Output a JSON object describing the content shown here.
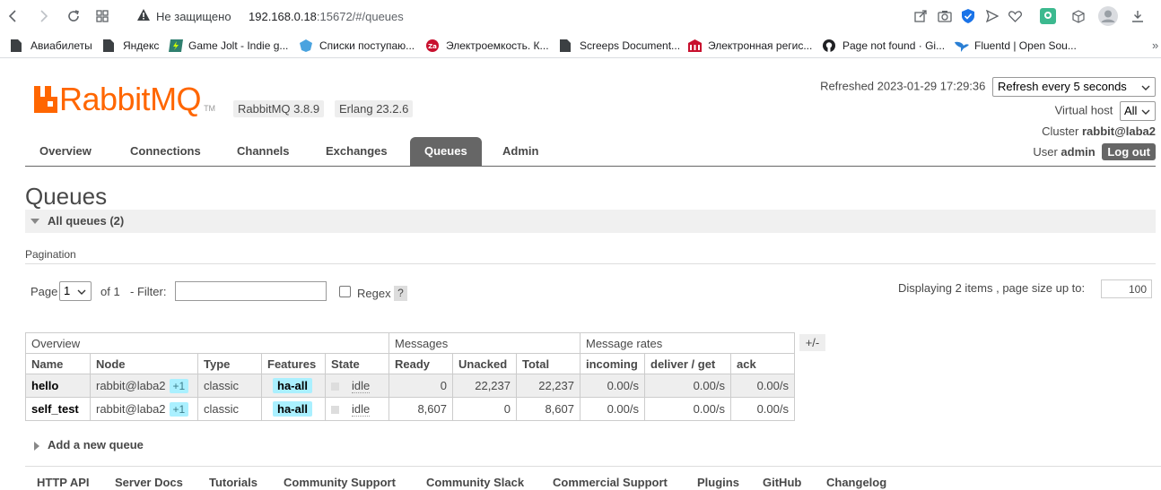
{
  "browser": {
    "insecure_label": "Не защищено",
    "url_host": "192.168.0.18",
    "url_rest": ":15672/#/queues",
    "bookmarks": [
      "Авиабилеты",
      "Яндекс",
      "Game Jolt - Indie g...",
      "Списки поступаю...",
      "Электроемкость. К...",
      "Screeps Document...",
      "Электронная регис...",
      "Page not found · Gi...",
      "Fluentd | Open Sou..."
    ],
    "more": "»"
  },
  "header": {
    "logo_text": "RabbitMQ",
    "logo_tm": "TM",
    "rabbit_version": "RabbitMQ 3.8.9",
    "erlang_version": "Erlang 23.2.6",
    "refreshed_label": "Refreshed 2023-01-29 17:29:36",
    "refresh_select": "Refresh every 5 seconds",
    "vhost_label": "Virtual host",
    "vhost_value": "All",
    "cluster_label": "Cluster",
    "cluster_value": "rabbit@laba2",
    "user_label": "User",
    "user_value": "admin",
    "logout": "Log out"
  },
  "tabs": [
    "Overview",
    "Connections",
    "Channels",
    "Exchanges",
    "Queues",
    "Admin"
  ],
  "active_tab": "Queues",
  "page_title": "Queues",
  "section": {
    "title": "All queues (2)"
  },
  "pagination": {
    "heading": "Pagination",
    "page_label": "Page",
    "page_value": "1",
    "of_label": "of 1",
    "filter_label": "- Filter:",
    "regex_label": "Regex",
    "help": "?",
    "display_info": "Displaying 2 items , page size up to:",
    "page_size": "100"
  },
  "table": {
    "groups": [
      "Overview",
      "Messages",
      "Message rates"
    ],
    "toggle": "+/-",
    "columns": [
      "Name",
      "Node",
      "Type",
      "Features",
      "State",
      "Ready",
      "Unacked",
      "Total",
      "incoming",
      "deliver / get",
      "ack"
    ],
    "rows": [
      {
        "name": "hello",
        "node": "rabbit@laba2",
        "node_extra": "+1",
        "type": "classic",
        "features": "ha-all",
        "state": "idle",
        "ready": "0",
        "unacked": "22,237",
        "total": "22,237",
        "incoming": "0.00/s",
        "deliver_get": "0.00/s",
        "ack": "0.00/s"
      },
      {
        "name": "self_test",
        "node": "rabbit@laba2",
        "node_extra": "+1",
        "type": "classic",
        "features": "ha-all",
        "state": "idle",
        "ready": "8,607",
        "unacked": "0",
        "total": "8,607",
        "incoming": "0.00/s",
        "deliver_get": "0.00/s",
        "ack": "0.00/s"
      }
    ]
  },
  "add_queue": "Add a new queue",
  "footer_links": [
    "HTTP API",
    "Server Docs",
    "Tutorials",
    "Community Support",
    "Community Slack",
    "Commercial Support",
    "Plugins",
    "GitHub",
    "Changelog"
  ],
  "colors": {
    "brand_orange": "#ff6600",
    "tab_active": "#666666",
    "badge_cyan": "#aaf0ff"
  }
}
